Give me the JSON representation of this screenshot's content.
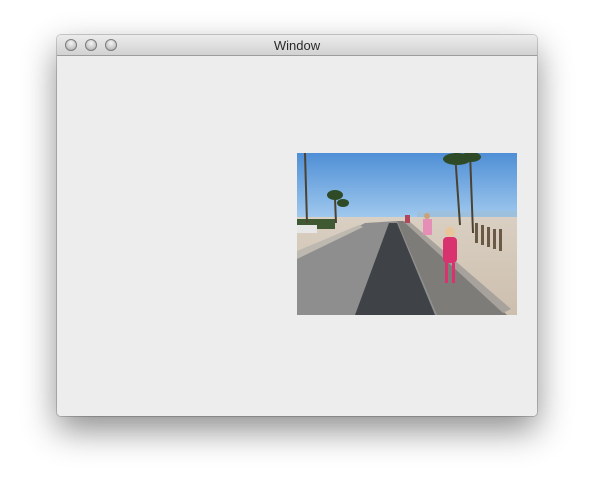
{
  "window": {
    "title": "Window",
    "controls": [
      "close",
      "minimize",
      "zoom"
    ]
  },
  "content": {
    "image_subject": "beach-boardwalk-photo"
  }
}
